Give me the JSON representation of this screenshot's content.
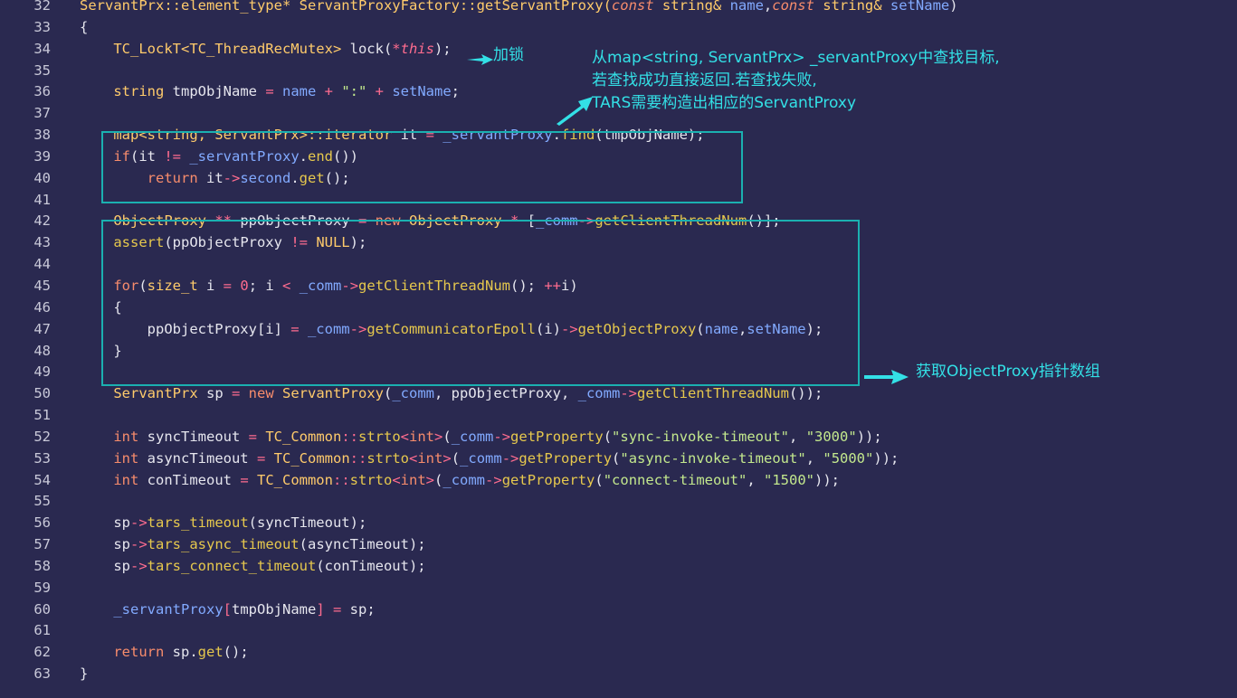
{
  "code_lines": [
    {
      "num": "32",
      "tokens": [
        [
          "ServantPrx::element_type* ServantProxyFactory::getServantProxy(",
          "t-ty"
        ],
        [
          "const",
          "t-kwi"
        ],
        [
          " string& ",
          "t-ty"
        ],
        [
          "name",
          "t-var"
        ],
        [
          ",",
          "t-pun"
        ],
        [
          "const",
          "t-kwi"
        ],
        [
          " string& ",
          "t-ty"
        ],
        [
          "setName",
          "t-var"
        ],
        [
          ")",
          "t-pun"
        ]
      ]
    },
    {
      "num": "33",
      "tokens": [
        [
          "{",
          "t-pun"
        ]
      ]
    },
    {
      "num": "34",
      "tokens": [
        [
          "    ",
          "t-pun"
        ],
        [
          "TC_LockT<TC_ThreadRecMutex>",
          "t-ty"
        ],
        [
          " lock(",
          "t-id"
        ],
        [
          "*",
          "t-op"
        ],
        [
          "this",
          "t-this"
        ],
        [
          ");",
          "t-pun"
        ]
      ]
    },
    {
      "num": "35",
      "tokens": []
    },
    {
      "num": "36",
      "tokens": [
        [
          "    ",
          "t-pun"
        ],
        [
          "string",
          "t-ty"
        ],
        [
          " tmpObjName ",
          "t-id"
        ],
        [
          "=",
          "t-op"
        ],
        [
          " name ",
          "t-var"
        ],
        [
          "+",
          "t-op"
        ],
        [
          " \":\" ",
          "t-str"
        ],
        [
          "+",
          "t-op"
        ],
        [
          " setName",
          "t-var"
        ],
        [
          ";",
          "t-pun"
        ]
      ]
    },
    {
      "num": "37",
      "tokens": []
    },
    {
      "num": "38",
      "tokens": [
        [
          "    ",
          "t-pun"
        ],
        [
          "map<string, ServantPrx>::iterator",
          "t-ty"
        ],
        [
          " it ",
          "t-id"
        ],
        [
          "=",
          "t-op"
        ],
        [
          " _servantProxy",
          "t-var"
        ],
        [
          ".",
          "t-pun"
        ],
        [
          "find",
          "t-fn"
        ],
        [
          "(tmpObjName);",
          "t-id"
        ]
      ]
    },
    {
      "num": "39",
      "tokens": [
        [
          "    ",
          "t-pun"
        ],
        [
          "if",
          "t-kw"
        ],
        [
          "(it ",
          "t-id"
        ],
        [
          "!=",
          "t-op"
        ],
        [
          " _servantProxy",
          "t-var"
        ],
        [
          ".",
          "t-pun"
        ],
        [
          "end",
          "t-fn"
        ],
        [
          "())",
          "t-pun"
        ]
      ]
    },
    {
      "num": "40",
      "tokens": [
        [
          "        ",
          "t-pun"
        ],
        [
          "return",
          "t-kw"
        ],
        [
          " it",
          "t-id"
        ],
        [
          "->",
          "t-op"
        ],
        [
          "second",
          "t-var"
        ],
        [
          ".",
          "t-pun"
        ],
        [
          "get",
          "t-fn"
        ],
        [
          "();",
          "t-pun"
        ]
      ]
    },
    {
      "num": "41",
      "tokens": []
    },
    {
      "num": "42",
      "tokens": [
        [
          "    ",
          "t-pun"
        ],
        [
          "ObjectProxy",
          "t-ty"
        ],
        [
          " ** ",
          "t-op"
        ],
        [
          "ppObjectProxy ",
          "t-id"
        ],
        [
          "=",
          "t-op"
        ],
        [
          " new ",
          "t-kw"
        ],
        [
          "ObjectProxy",
          "t-ty"
        ],
        [
          " * ",
          "t-op"
        ],
        [
          "[",
          "t-pun"
        ],
        [
          "_comm",
          "t-var"
        ],
        [
          "->",
          "t-op"
        ],
        [
          "getClientThreadNum",
          "t-fn"
        ],
        [
          "()];",
          "t-pun"
        ]
      ]
    },
    {
      "num": "43",
      "tokens": [
        [
          "    ",
          "t-pun"
        ],
        [
          "assert",
          "t-fn"
        ],
        [
          "(ppObjectProxy ",
          "t-id"
        ],
        [
          "!=",
          "t-op"
        ],
        [
          " NULL",
          "t-ty"
        ],
        [
          ");",
          "t-pun"
        ]
      ]
    },
    {
      "num": "44",
      "tokens": []
    },
    {
      "num": "45",
      "tokens": [
        [
          "    ",
          "t-pun"
        ],
        [
          "for",
          "t-kw"
        ],
        [
          "(",
          "t-pun"
        ],
        [
          "size_t",
          "t-ty"
        ],
        [
          " i ",
          "t-id"
        ],
        [
          "=",
          "t-op"
        ],
        [
          " 0",
          "t-num"
        ],
        [
          "; i ",
          "t-id"
        ],
        [
          "<",
          "t-op"
        ],
        [
          " _comm",
          "t-var"
        ],
        [
          "->",
          "t-op"
        ],
        [
          "getClientThreadNum",
          "t-fn"
        ],
        [
          "(); ",
          "t-pun"
        ],
        [
          "++",
          "t-op"
        ],
        [
          "i)",
          "t-id"
        ]
      ]
    },
    {
      "num": "46",
      "tokens": [
        [
          "    {",
          "t-pun"
        ]
      ]
    },
    {
      "num": "47",
      "tokens": [
        [
          "        ppObjectProxy[i] ",
          "t-id"
        ],
        [
          "=",
          "t-op"
        ],
        [
          " _comm",
          "t-var"
        ],
        [
          "->",
          "t-op"
        ],
        [
          "getCommunicatorEpoll",
          "t-fn"
        ],
        [
          "(i)",
          "t-id"
        ],
        [
          "->",
          "t-op"
        ],
        [
          "getObjectProxy",
          "t-fn"
        ],
        [
          "(",
          "t-pun"
        ],
        [
          "name",
          "t-var"
        ],
        [
          ",",
          "t-pun"
        ],
        [
          "setName",
          "t-var"
        ],
        [
          ");",
          "t-pun"
        ]
      ]
    },
    {
      "num": "48",
      "tokens": [
        [
          "    }",
          "t-pun"
        ]
      ]
    },
    {
      "num": "49",
      "tokens": []
    },
    {
      "num": "50",
      "tokens": [
        [
          "    ",
          "t-pun"
        ],
        [
          "ServantPrx",
          "t-ty"
        ],
        [
          " sp ",
          "t-id"
        ],
        [
          "=",
          "t-op"
        ],
        [
          " new ",
          "t-kw"
        ],
        [
          "ServantProxy",
          "t-ty"
        ],
        [
          "(",
          "t-pun"
        ],
        [
          "_comm",
          "t-var"
        ],
        [
          ", ppObjectProxy, ",
          "t-id"
        ],
        [
          "_comm",
          "t-var"
        ],
        [
          "->",
          "t-op"
        ],
        [
          "getClientThreadNum",
          "t-fn"
        ],
        [
          "());",
          "t-pun"
        ]
      ]
    },
    {
      "num": "51",
      "tokens": []
    },
    {
      "num": "52",
      "tokens": [
        [
          "    ",
          "t-pun"
        ],
        [
          "int",
          "t-kw"
        ],
        [
          " syncTimeout ",
          "t-id"
        ],
        [
          "=",
          "t-op"
        ],
        [
          " TC_Common",
          "t-ty"
        ],
        [
          "::",
          "t-op"
        ],
        [
          "strto",
          "t-fn"
        ],
        [
          "<",
          "t-op"
        ],
        [
          "int",
          "t-kw"
        ],
        [
          ">",
          "t-op"
        ],
        [
          "(",
          "t-pun"
        ],
        [
          "_comm",
          "t-var"
        ],
        [
          "->",
          "t-op"
        ],
        [
          "getProperty",
          "t-fn"
        ],
        [
          "(",
          "t-pun"
        ],
        [
          "\"sync-invoke-timeout\"",
          "t-str"
        ],
        [
          ", ",
          "t-pun"
        ],
        [
          "\"3000\"",
          "t-str"
        ],
        [
          "));",
          "t-pun"
        ]
      ]
    },
    {
      "num": "53",
      "tokens": [
        [
          "    ",
          "t-pun"
        ],
        [
          "int",
          "t-kw"
        ],
        [
          " asyncTimeout ",
          "t-id"
        ],
        [
          "=",
          "t-op"
        ],
        [
          " TC_Common",
          "t-ty"
        ],
        [
          "::",
          "t-op"
        ],
        [
          "strto",
          "t-fn"
        ],
        [
          "<",
          "t-op"
        ],
        [
          "int",
          "t-kw"
        ],
        [
          ">",
          "t-op"
        ],
        [
          "(",
          "t-pun"
        ],
        [
          "_comm",
          "t-var"
        ],
        [
          "->",
          "t-op"
        ],
        [
          "getProperty",
          "t-fn"
        ],
        [
          "(",
          "t-pun"
        ],
        [
          "\"async-invoke-timeout\"",
          "t-str"
        ],
        [
          ", ",
          "t-pun"
        ],
        [
          "\"5000\"",
          "t-str"
        ],
        [
          "));",
          "t-pun"
        ]
      ]
    },
    {
      "num": "54",
      "tokens": [
        [
          "    ",
          "t-pun"
        ],
        [
          "int",
          "t-kw"
        ],
        [
          " conTimeout ",
          "t-id"
        ],
        [
          "=",
          "t-op"
        ],
        [
          " TC_Common",
          "t-ty"
        ],
        [
          "::",
          "t-op"
        ],
        [
          "strto",
          "t-fn"
        ],
        [
          "<",
          "t-op"
        ],
        [
          "int",
          "t-kw"
        ],
        [
          ">",
          "t-op"
        ],
        [
          "(",
          "t-pun"
        ],
        [
          "_comm",
          "t-var"
        ],
        [
          "->",
          "t-op"
        ],
        [
          "getProperty",
          "t-fn"
        ],
        [
          "(",
          "t-pun"
        ],
        [
          "\"connect-timeout\"",
          "t-str"
        ],
        [
          ", ",
          "t-pun"
        ],
        [
          "\"1500\"",
          "t-str"
        ],
        [
          "));",
          "t-pun"
        ]
      ]
    },
    {
      "num": "55",
      "tokens": []
    },
    {
      "num": "56",
      "tokens": [
        [
          "    sp",
          "t-id"
        ],
        [
          "->",
          "t-op"
        ],
        [
          "tars_timeout",
          "t-fn"
        ],
        [
          "(syncTimeout);",
          "t-id"
        ]
      ]
    },
    {
      "num": "57",
      "tokens": [
        [
          "    sp",
          "t-id"
        ],
        [
          "->",
          "t-op"
        ],
        [
          "tars_async_timeout",
          "t-fn"
        ],
        [
          "(asyncTimeout);",
          "t-id"
        ]
      ]
    },
    {
      "num": "58",
      "tokens": [
        [
          "    sp",
          "t-id"
        ],
        [
          "->",
          "t-op"
        ],
        [
          "tars_connect_timeout",
          "t-fn"
        ],
        [
          "(conTimeout);",
          "t-id"
        ]
      ]
    },
    {
      "num": "59",
      "tokens": []
    },
    {
      "num": "60",
      "tokens": [
        [
          "    ",
          "t-pun"
        ],
        [
          "_servantProxy",
          "t-var"
        ],
        [
          "[",
          "t-op"
        ],
        [
          "tmpObjName",
          "t-id"
        ],
        [
          "]",
          "t-op"
        ],
        [
          " = ",
          "t-op"
        ],
        [
          "sp;",
          "t-id"
        ]
      ]
    },
    {
      "num": "61",
      "tokens": []
    },
    {
      "num": "62",
      "tokens": [
        [
          "    ",
          "t-pun"
        ],
        [
          "return",
          "t-kw"
        ],
        [
          " sp",
          "t-id"
        ],
        [
          ".",
          "t-pun"
        ],
        [
          "get",
          "t-fn"
        ],
        [
          "();",
          "t-pun"
        ]
      ]
    },
    {
      "num": "63",
      "tokens": [
        [
          "}",
          "t-pun"
        ]
      ]
    }
  ],
  "annotations": {
    "lock": "加锁",
    "map_line1": "从map<string, ServantPrx> _servantProxy中查找目标,",
    "map_line2": "若查找成功直接返回.若查找失败,",
    "map_line3": "TARS需要构造出相应的ServantProxy",
    "objproxy": "获取ObjectProxy指针数组"
  },
  "colors": {
    "background": "#2a2950",
    "annotation": "#33e0e6",
    "box_border": "#1bb0b0"
  }
}
